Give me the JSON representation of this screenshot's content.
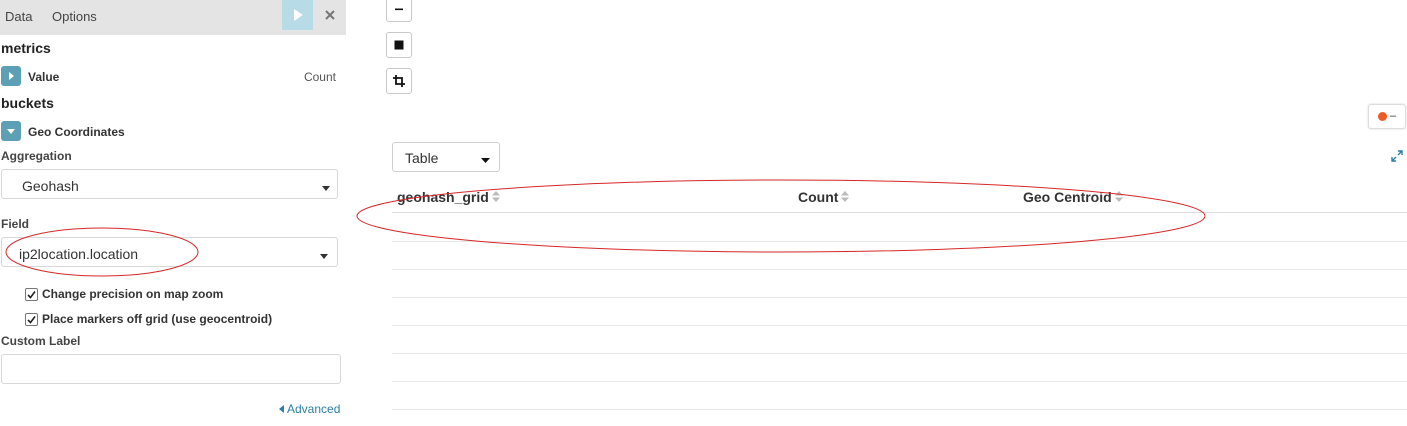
{
  "sidebar": {
    "tabs": [
      {
        "label": "Data",
        "active": true
      },
      {
        "label": "Options",
        "active": false
      }
    ],
    "metrics": {
      "heading": "metrics",
      "item": {
        "title": "Value",
        "description": "Count",
        "icon": "caret-right-icon"
      }
    },
    "buckets": {
      "heading": "buckets",
      "item": {
        "title": "Geo Coordinates",
        "icon": "caret-down-icon"
      },
      "aggregation": {
        "label": "Aggregation",
        "value": "Geohash"
      },
      "field": {
        "label": "Field",
        "value": "ip2location.location"
      },
      "checkboxes": [
        {
          "label": "Change precision on map zoom",
          "checked": true
        },
        {
          "label": "Place markers off grid (use geocentroid)",
          "checked": true
        }
      ],
      "custom_label": {
        "label": "Custom Label",
        "value": ""
      },
      "advanced_link": "Advanced"
    }
  },
  "map_controls": [
    "zoom-out-icon",
    "square-draw-icon",
    "crop-icon"
  ],
  "legend": {
    "dot_color": "#f05a24",
    "label": "–"
  },
  "table": {
    "view_select": "Table",
    "columns": [
      "geohash_grid",
      "Count",
      "Geo Centroid"
    ],
    "rows": []
  },
  "colors": {
    "accent": "#5d9fb5",
    "apply_button": "#b7dbe7",
    "link": "#2a7fa3",
    "annotation": "#d62728"
  }
}
